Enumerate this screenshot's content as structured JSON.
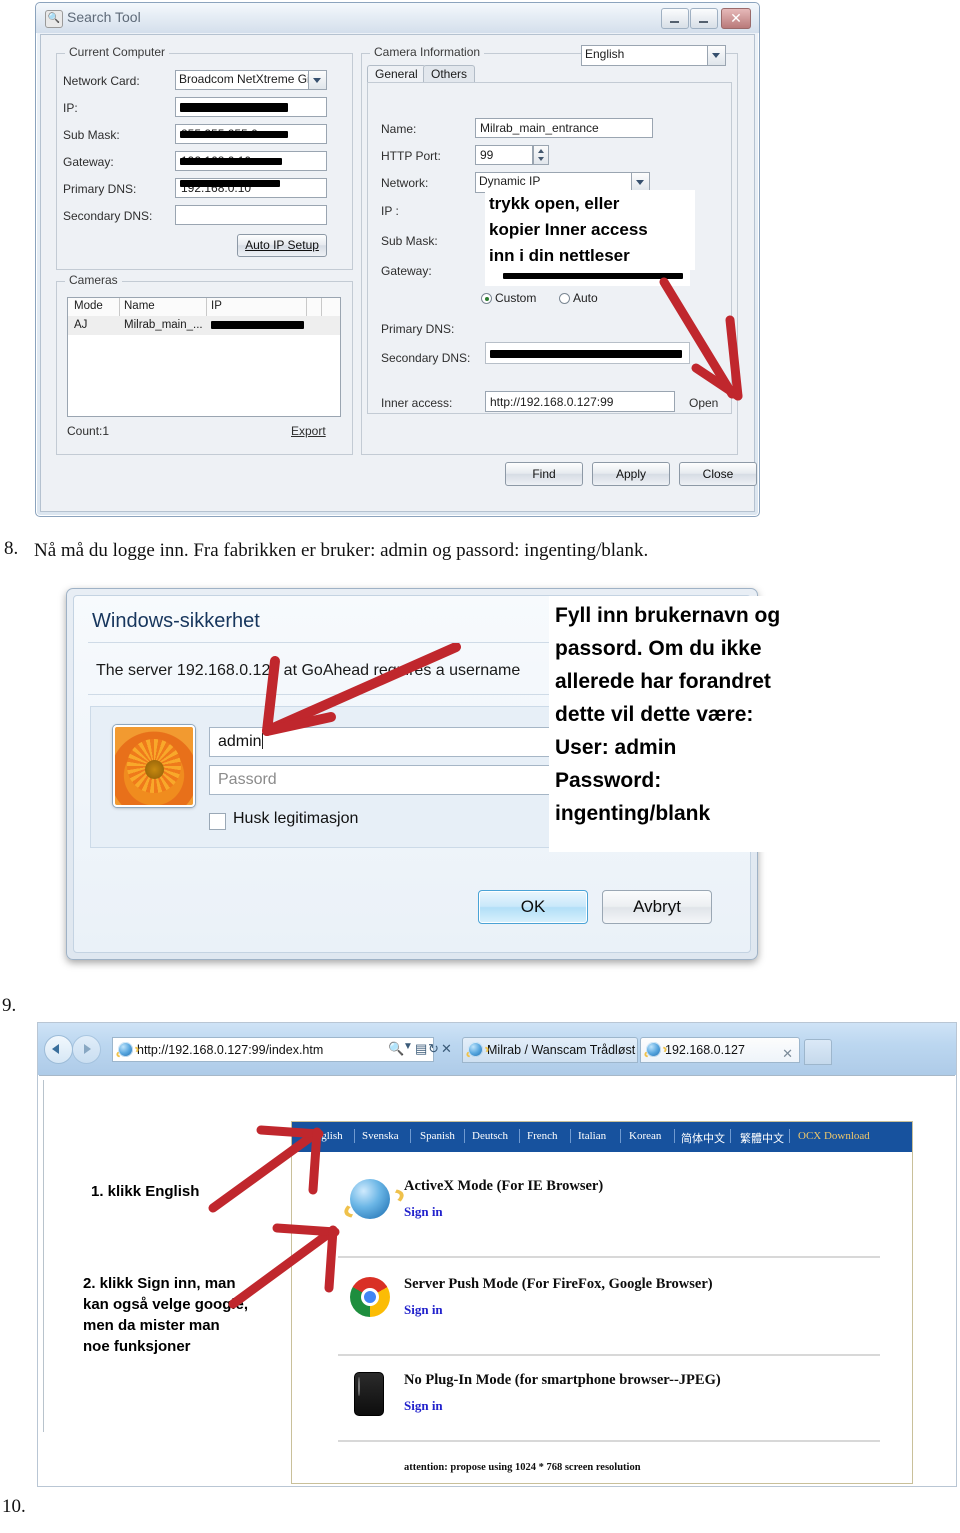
{
  "search_tool": {
    "window_title": "Search Tool",
    "window_buttons": {
      "minimize": "_",
      "maximize": "_",
      "close": "✕"
    },
    "current_computer": {
      "legend": "Current Computer",
      "fields": [
        {
          "label": "Network Card:",
          "value": "Broadcom NetXtreme Gig",
          "type": "combo"
        },
        {
          "label": "IP:",
          "value": "",
          "type": "redacted"
        },
        {
          "label": "Sub Mask:",
          "value": "255.255.255.0",
          "type": "redacted"
        },
        {
          "label": "Gateway:",
          "value": "192.168.0.10",
          "type": "redacted"
        },
        {
          "label": "Primary DNS:",
          "value": "192.168.0.10",
          "type": "redacted"
        },
        {
          "label": "Secondary DNS:",
          "value": "",
          "type": "text"
        }
      ],
      "auto_ip_button": "Auto IP Setup"
    },
    "cameras": {
      "legend": "Cameras",
      "columns": [
        "Mode",
        "Name",
        "IP"
      ],
      "rows": [
        {
          "mode": "AJ",
          "name": "Milrab_main_...",
          "ip": ""
        }
      ],
      "count_label": "Count:1",
      "export_label": "Export"
    },
    "camera_information": {
      "legend": "Camera Information",
      "language": "English",
      "tabs": [
        {
          "label": "General",
          "active": true
        },
        {
          "label": "Others",
          "active": false
        }
      ],
      "fields": [
        {
          "label": "Name:",
          "value": "Milrab_main_entrance"
        },
        {
          "label": "HTTP Port:",
          "value": "99"
        },
        {
          "label": "Network:",
          "value": "Dynamic IP"
        },
        {
          "label": "IP :",
          "value": ""
        },
        {
          "label": "Sub Mask:",
          "value": ""
        },
        {
          "label": "Gateway:",
          "value": ""
        },
        {
          "label": "Primary DNS:",
          "value": ""
        },
        {
          "label": "Secondary DNS:",
          "value": ""
        }
      ],
      "radios": [
        {
          "label": "Custom",
          "selected": true
        },
        {
          "label": "Auto",
          "selected": false
        }
      ],
      "inner_access_label": "Inner access:",
      "inner_access_value": "http://192.168.0.127:99",
      "open_label": "Open"
    },
    "footer_buttons": [
      "Find",
      "Apply",
      "Close"
    ],
    "annotation": {
      "line1": "trykk open, eller",
      "line2": "kopier Inner access",
      "line3": "inn i din nettleser"
    }
  },
  "step8": {
    "number": "8.",
    "text": "Nå må du logge inn. Fra fabrikken er bruker: admin og passord: ingenting/blank."
  },
  "windows_security": {
    "title": "Windows-sikkerhet",
    "message": "The server 192.168.0.127 at GoAhead requires a username",
    "username_value": "admin",
    "password_placeholder": "Passord",
    "remember_label": "Husk legitimasjon",
    "ok_label": "OK",
    "cancel_label": "Avbryt",
    "annotation": {
      "line1": "Fyll inn brukernavn og",
      "line2": "passord. Om du ikke",
      "line3": "allerede har forandret",
      "line4": "dette vil dette være:",
      "line5": "User: admin",
      "line6": "Password:",
      "line7": "ingenting/blank"
    }
  },
  "step9": {
    "number": "9.",
    "browser": {
      "address": "http://192.168.0.127:99/index.htm",
      "address_icons": [
        "search-icon",
        "compat-view-icon",
        "refresh-icon",
        "stop-icon"
      ],
      "tabs": [
        {
          "label": "Milrab / Wanscam Trådløst ov...",
          "active": false
        },
        {
          "label": "192.168.0.127",
          "active": true,
          "close": "✕"
        }
      ]
    },
    "camera_page": {
      "languages": [
        "English",
        "Svenska",
        "Spanish",
        "Deutsch",
        "French",
        "Italian",
        "Korean",
        "简体中文",
        "繁體中文"
      ],
      "ocx_download": "OCX Download",
      "modes": [
        {
          "icon": "internet-explorer-icon",
          "title": "ActiveX Mode (For IE Browser)",
          "link": "Sign in"
        },
        {
          "icon": "google-chrome-icon",
          "title": "Server Push Mode (For FireFox, Google Browser)",
          "link": "Sign in"
        },
        {
          "icon": "smartphone-icon",
          "title": "No Plug-In Mode (for smartphone browser--JPEG)",
          "link": "Sign in"
        }
      ],
      "attention": "attention: propose using 1024 * 768 screen resolution"
    },
    "annotation": {
      "line1": "1. klikk English",
      "line2a": "2. klikk Sign inn, man",
      "line2b": "kan også velge google,",
      "line2c": "men da mister man",
      "line2d": "noe funksjoner"
    }
  },
  "step10": {
    "number": "10."
  },
  "colors": {
    "annotation_arrow": "#c0272d",
    "langbar_blue": "#17529e",
    "link_blue": "#2222cc",
    "ocx_gold": "#f0c86a"
  }
}
